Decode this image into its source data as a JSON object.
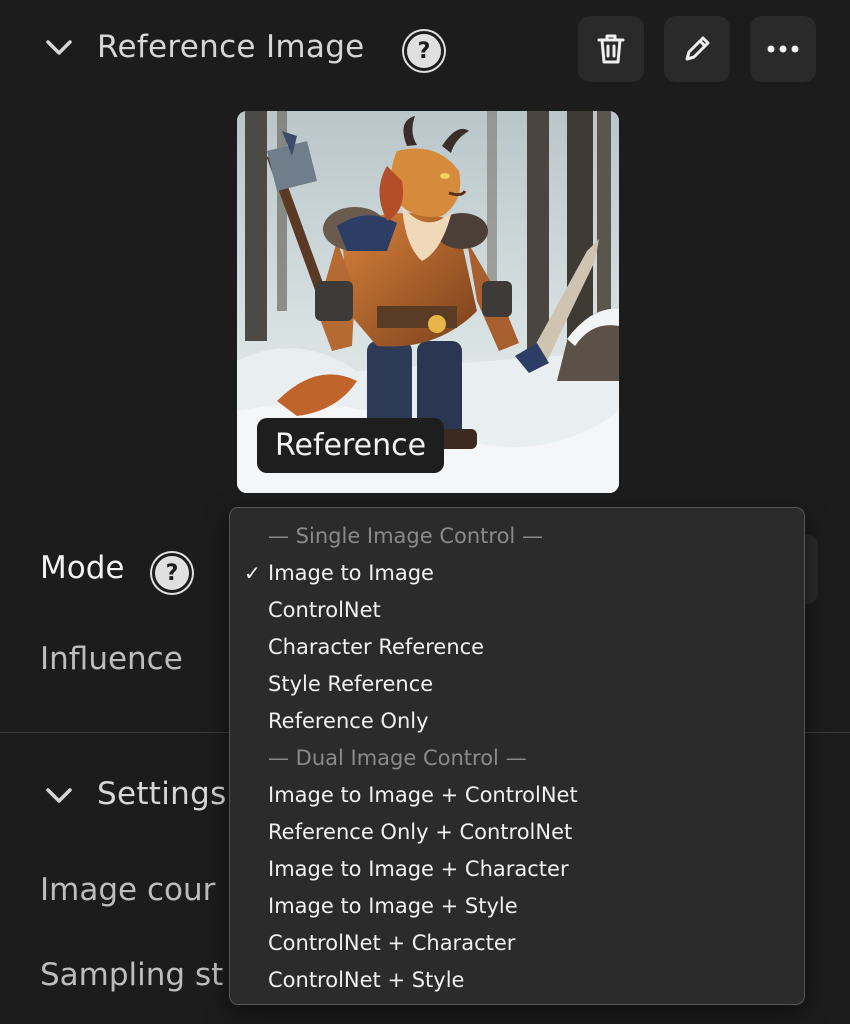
{
  "reference_section": {
    "title": "Reference Image",
    "help_icon": "question-circle-icon",
    "actions": [
      {
        "name": "delete",
        "icon": "trash-icon"
      },
      {
        "name": "edit",
        "icon": "pencil-icon"
      },
      {
        "name": "more",
        "icon": "more-horizontal-icon"
      }
    ],
    "thumbnail_label": "Reference"
  },
  "mode": {
    "label": "Mode",
    "help_icon": "question-circle-icon"
  },
  "influence": {
    "label": "Influence"
  },
  "settings_section": {
    "title": "Settings"
  },
  "settings_rows": [
    {
      "label": "Image cour"
    },
    {
      "label": "Sampling st"
    }
  ],
  "dropdown": {
    "groups": [
      {
        "header": "— Single Image Control —",
        "options": [
          "Image to Image",
          "ControlNet",
          "Character Reference",
          "Style Reference",
          "Reference Only"
        ]
      },
      {
        "header": "— Dual Image Control —",
        "options": [
          "Image to Image + ControlNet",
          "Reference Only + ControlNet",
          "Image to Image + Character",
          "Image to Image + Style",
          "ControlNet + Character",
          "ControlNet + Style"
        ]
      }
    ],
    "selected": "Image to Image",
    "check_glyph": "✓"
  },
  "colors": {
    "background": "#1c1c1c",
    "panel": "#2a2a2a",
    "menu": "#2b2b2b",
    "text": "#f0f0f0",
    "muted": "#8a8a8a"
  }
}
